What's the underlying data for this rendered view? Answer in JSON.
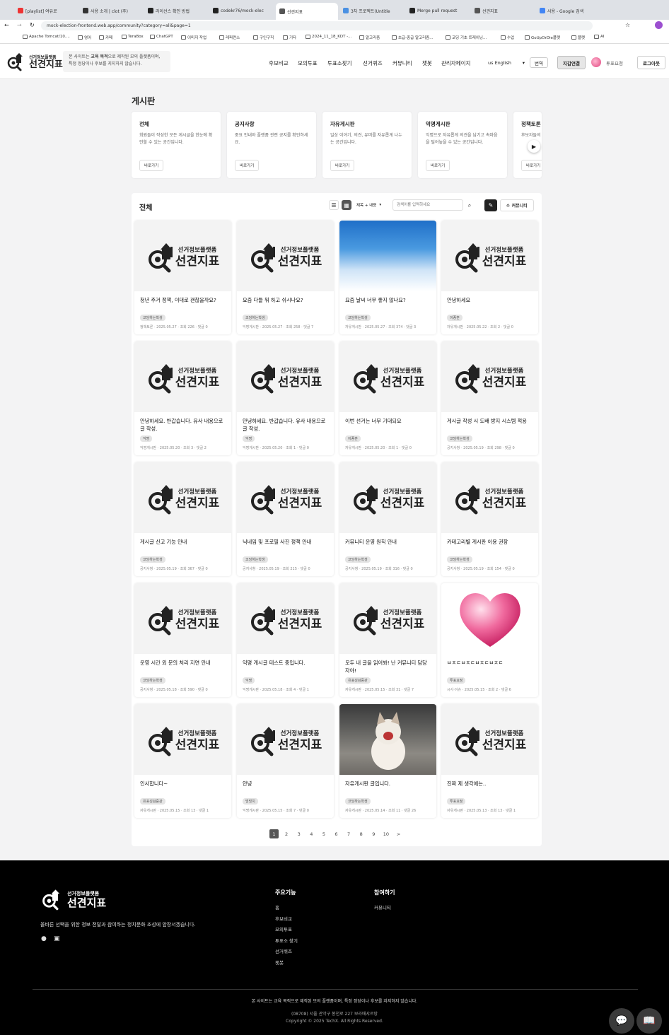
{
  "browser": {
    "tabs": [
      "[playlist] 여유로",
      "사용 소개 | clot (주)",
      "라이선스 확인 방법",
      "codekr76/mock-elec",
      "선견지표",
      "3차 프로젝트(Untitle",
      "Merge pull request",
      "선견지표",
      "사용 - Google 검색"
    ],
    "url": "mock-election-frontend.web.app/community?category=all&page=1",
    "bookmarks": [
      "Apache Tomcat/10....",
      "영어",
      "카페",
      "TeraBox",
      "ChatGPT",
      "이미지 작업",
      "레퍼런스",
      "구인구직",
      "기타",
      "2024_11_18_KDT -...",
      "알고리즘",
      "초급-중급 알고리즘...",
      "코딩 기초 트레이닝...",
      "수업",
      "GoUpOrDie플랫",
      "플랫",
      "AI"
    ]
  },
  "header": {
    "logo_sub": "선거정보플랫폼",
    "logo_main": "선견지표",
    "notice_pre": "본 사이트는 ",
    "notice_bold": "교육 목적",
    "notice_post": "으로 제작된 모의 플랫폼이며, 특정 정당이나 후보를 지지하지 않습니다.",
    "nav": [
      "후보비교",
      "모의투표",
      "투표소찾기",
      "선거퀴즈",
      "커뮤니티",
      "챗봇",
      "관리자페이지"
    ],
    "lang": "us English",
    "translate": "번역",
    "wallet": "지갑연결",
    "vote_request": "투표요청",
    "logout": "로그아웃"
  },
  "board": {
    "title": "게시판",
    "go_label": "바로가기",
    "categories": [
      {
        "name": "전체",
        "desc": "회원들이 작성한 모든 게시글을 한눈에 확인할 수 있는 공간입니다."
      },
      {
        "name": "공지사항",
        "desc": "중요 안내와 플랫폼 관련 공지를 확인하세요."
      },
      {
        "name": "자유게시판",
        "desc": "일상 이야기, 의견, 유머를 자유롭게 나누는 공간입니다."
      },
      {
        "name": "익명게시판",
        "desc": "익명으로 자유롭게 의견을 남기고 속마음을 털어놓을 수 있는 공간입니다."
      },
      {
        "name": "정책토론",
        "desc": "후보자들의 정책을 두고"
      }
    ]
  },
  "list": {
    "title": "전체",
    "search_scope": "제목 + 내용",
    "search_placeholder": "검색어를 입력하세요",
    "community_button": "커뮤니티",
    "posts": [
      {
        "title": "청년 주거 정책, 이대로 괜찮을까요?",
        "tag": "코딩하는학생",
        "meta": "정책토론 · 2025.05.27 · 조회 226 · 댓글 0",
        "img": "logo"
      },
      {
        "title": "요즘 다들 뭐 하고 쉬시나요?",
        "tag": "코딩하는학생",
        "meta": "익명게시판 · 2025.05.27 · 조회 258 · 댓글 7",
        "img": "logo"
      },
      {
        "title": "요즘 날씨 너무 좋지 않나요?",
        "tag": "코딩하는학생",
        "meta": "자유게시판 · 2025.05.27 · 조회 374 · 댓글 3",
        "img": "sky"
      },
      {
        "title": "안녕하세요",
        "tag": "이종훈",
        "meta": "자유게시판 · 2025.05.22 · 조회 2 · 댓글 0",
        "img": "logo"
      },
      {
        "title": "안녕하세요. 반갑습니다. 유사 내용으로 글 작성.",
        "tag": "익명",
        "meta": "익명게시판 · 2025.05.20 · 조회 3 · 댓글 2",
        "img": "logo"
      },
      {
        "title": "안녕하세요. 반갑습니다. 유사 내용으로 글 작성.",
        "tag": "익명",
        "meta": "익명게시판 · 2025.05.20 · 조회 1 · 댓글 0",
        "img": "logo"
      },
      {
        "title": "이번 선거는 너무 기대되요",
        "tag": "이종훈",
        "meta": "자유게시판 · 2025.05.20 · 조회 1 · 댓글 0",
        "img": "logo"
      },
      {
        "title": "게시글 작성 시 도배 방지 시스템 적용",
        "tag": "코딩하는학생",
        "meta": "공지사항 · 2025.05.19 · 조회 298 · 댓글 0",
        "img": "logo"
      },
      {
        "title": "게시글 신고 기능 안내",
        "tag": "코딩하는학생",
        "meta": "공지사항 · 2025.05.19 · 조회 367 · 댓글 0",
        "img": "logo"
      },
      {
        "title": "닉네임 및 프로필 사진 정책 안내",
        "tag": "코딩하는학생",
        "meta": "공지사항 · 2025.05.19 · 조회 215 · 댓글 0",
        "img": "logo"
      },
      {
        "title": "커뮤니티 운영 원칙 안내",
        "tag": "코딩하는학생",
        "meta": "공지사항 · 2025.05.19 · 조회 316 · 댓글 0",
        "img": "logo"
      },
      {
        "title": "카테고리별 게시판 이용 권장",
        "tag": "코딩하는학생",
        "meta": "공지사항 · 2025.05.19 · 조회 154 · 댓글 0",
        "img": "logo"
      },
      {
        "title": "운영 시간 외 문의 처리 지연 안내",
        "tag": "코딩하는학생",
        "meta": "공지사항 · 2025.05.18 · 조회 590 · 댓글 0",
        "img": "logo"
      },
      {
        "title": "익명 게시글 테스트 중입니다.",
        "tag": "익명",
        "meta": "익명게시판 · 2025.05.18 · 조회 4 · 댓글 1",
        "img": "logo"
      },
      {
        "title": "모두 내 글을 읽어봐! 난 커뮤니티 담당자야!",
        "tag": "유표성검증관",
        "meta": "자유게시판 · 2025.05.15 · 조회 31 · 댓글 7",
        "img": "logo"
      },
      {
        "title": "ㅂㅈㄷㅂㅈㄷㅂㅈㄷㅂㅈㄷ",
        "tag": "투표요정",
        "meta": "시사·이슈 · 2025.05.15 · 조회 2 · 댓글 6",
        "img": "heart"
      },
      {
        "title": "인사합니다~",
        "tag": "유표성검증관",
        "meta": "자유게시판 · 2025.05.15 · 조회 13 · 댓글 1",
        "img": "logo"
      },
      {
        "title": "안녕",
        "tag": "멍멍치",
        "meta": "익명게시판 · 2025.05.15 · 조회 7 · 댓글 0",
        "img": "logo"
      },
      {
        "title": "자유게시판 글입니다.",
        "tag": "코딩하는학생",
        "meta": "자유게시판 · 2025.05.14 · 조회 11 · 댓글 26",
        "img": "cat"
      },
      {
        "title": "진짜 제 생각에는..",
        "tag": "투표요정",
        "meta": "자유게시판 · 2025.05.13 · 조회 13 · 댓글 1",
        "img": "logo"
      }
    ],
    "pages": [
      "1",
      "2",
      "3",
      "4",
      "5",
      "6",
      "7",
      "8",
      "9",
      "10",
      ">"
    ],
    "current_page": "1"
  },
  "footer": {
    "tagline": "올바른 선택을 위한 정보 전달과 참여하는 정치문화 조성에 앞장서겠습니다.",
    "col1_title": "주요기능",
    "col1": [
      "홈",
      "후보비교",
      "모의투표",
      "투표소 찾기",
      "선거퀴즈",
      "챗봇"
    ],
    "col2_title": "참여하기",
    "col2": [
      "커뮤니티"
    ],
    "disclaimer": "본 사이트는 교육 목적으로 제작된 모의 플랫폼이며, 특정 정당이나 후보를 지지하지 않습니다.",
    "address": "(08708) 서울 관악구 봉천로 227 보라매샤르망",
    "copyright": "Copyright © 2025 TechX. All Rights Reserved."
  },
  "colors": {
    "accent": "#222222",
    "tag_bg": "#e4e4e4",
    "footer_bg": "#000000"
  }
}
